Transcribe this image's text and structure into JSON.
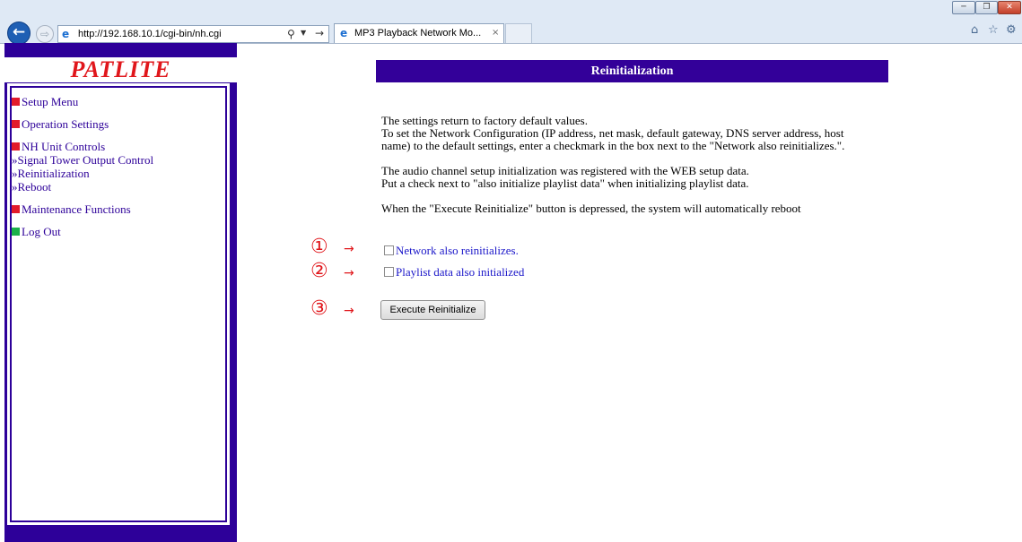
{
  "browser": {
    "url": "http://192.168.10.1/cgi-bin/nh.cgi",
    "tab_title": "MP3 Playback Network Mo...",
    "tab_close": "×",
    "icons": [
      "back-icon",
      "forward-icon",
      "ie-icon",
      "search-icon",
      "refresh-icon",
      "home-icon",
      "favorites-star-icon",
      "tools-gear-icon",
      "minimize-icon",
      "maximize-icon",
      "close-icon"
    ]
  },
  "sidebar": {
    "logo": "PATLITE",
    "items": [
      {
        "label": "Setup Menu",
        "marker": "red"
      },
      {
        "label": "Operation Settings",
        "marker": "red"
      },
      {
        "label": "NH Unit Controls",
        "marker": "red"
      },
      {
        "label": "»Signal Tower Output Control"
      },
      {
        "label": "»Reinitialization"
      },
      {
        "label": "»Reboot"
      },
      {
        "label": "Maintenance Functions",
        "marker": "red"
      },
      {
        "label": "Log Out",
        "marker": "green"
      }
    ],
    "colors": {
      "frame": "#2d0099",
      "red_marker": "#e21b2b",
      "green_marker": "#1bb04a",
      "logo": "#e0161b"
    }
  },
  "main": {
    "title": "Reinitialization",
    "paragraphs": [
      [
        "The settings return to factory default values.",
        "To set the Network Configuration (IP address, net mask, default gateway, DNS server address, host",
        "name) to the default settings, enter a checkmark in the box next to the \"Network also reinitializes.\"."
      ],
      [
        "The audio channel setup initialization was registered with the WEB setup data.",
        "Put a check next to \"also initialize playlist data\" when initializing playlist data."
      ],
      [
        "When the \"Execute Reinitialize\" button is depressed, the system will automatically reboot"
      ]
    ],
    "annotations": {
      "n1": "①",
      "n2": "②",
      "n3": "③",
      "arrow": "→"
    },
    "options": [
      {
        "label": "Network also reinitializes.",
        "checked": false
      },
      {
        "label": "Playlist data also initialized",
        "checked": false
      }
    ],
    "execute_button": "Execute Reinitialize",
    "colors": {
      "header_bar": "#330099",
      "option_text": "#1b17c9",
      "annotation": "#e0161b"
    }
  }
}
